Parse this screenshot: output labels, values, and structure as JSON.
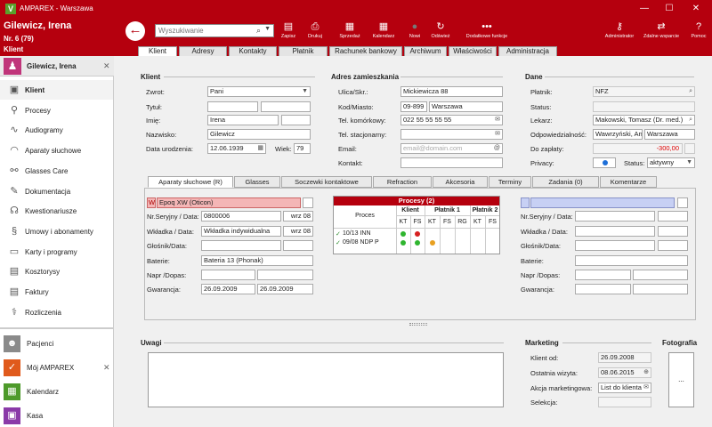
{
  "window": {
    "app": "AMPAREX",
    "location": "Warszawa",
    "minimize": "—",
    "maximize": "☐",
    "close": "✕"
  },
  "patient": {
    "name": "Gilewicz, Irena",
    "number": "Nr. 6 (79)",
    "type": "Klient"
  },
  "search": {
    "placeholder": "Wyszukiwanie"
  },
  "toolbar": [
    {
      "label": "Zapisz",
      "icon": "save-icon",
      "glyph": "▤"
    },
    {
      "label": "Drukuj",
      "icon": "print-icon",
      "glyph": "⎙"
    },
    {
      "label": "Sprzedaż",
      "icon": "sale-icon",
      "glyph": "▦"
    },
    {
      "label": "Kalendarz",
      "icon": "calendar-icon",
      "glyph": "▦"
    },
    {
      "label": "Nowi",
      "icon": "new-icon",
      "glyph": "●"
    },
    {
      "label": "Odśwież",
      "icon": "refresh-icon",
      "glyph": "↻"
    },
    {
      "label": "Dodatkowe funkcje",
      "icon": "more-icon",
      "glyph": "•••"
    },
    {
      "label": "Administrator",
      "icon": "key-icon",
      "glyph": "⚷"
    },
    {
      "label": "Zdalne wsparcie",
      "icon": "remote-icon",
      "glyph": "⇄"
    },
    {
      "label": "Pomoc",
      "icon": "help-icon",
      "glyph": "?"
    }
  ],
  "main_tabs": [
    "Klient",
    "Adresy",
    "Kontakty",
    "Płatnik",
    "Rachunek bankowy",
    "Archiwum",
    "Właściwości",
    "Administracja"
  ],
  "sidebar": {
    "patient": "Gilewicz, Irena",
    "items": [
      {
        "label": "Klient",
        "icon": "person-card-icon",
        "glyph": "▣"
      },
      {
        "label": "Procesy",
        "icon": "paperclip-icon",
        "glyph": "⚲"
      },
      {
        "label": "Audiogramy",
        "icon": "audiogram-icon",
        "glyph": "∿"
      },
      {
        "label": "Aparaty słuchowe",
        "icon": "hearing-aid-icon",
        "glyph": "◠"
      },
      {
        "label": "Glasses Care",
        "icon": "glasses-icon",
        "glyph": "⚯"
      },
      {
        "label": "Dokumentacja",
        "icon": "pencil-icon",
        "glyph": "✎"
      },
      {
        "label": "Kwestionariusze",
        "icon": "questionnaire-icon",
        "glyph": "☊"
      },
      {
        "label": "Umowy i abonamenty",
        "icon": "contract-icon",
        "glyph": "§"
      },
      {
        "label": "Karty i programy",
        "icon": "cards-icon",
        "glyph": "▭"
      },
      {
        "label": "Kosztorysy",
        "icon": "estimate-icon",
        "glyph": "▤"
      },
      {
        "label": "Faktury",
        "icon": "invoice-icon",
        "glyph": "▤"
      },
      {
        "label": "Rozliczenia",
        "icon": "caduceus-icon",
        "glyph": "⚕"
      }
    ],
    "nav": [
      {
        "label": "Pacjenci",
        "icon": "patients-icon",
        "glyph": "☻",
        "color": "#8a8a8a"
      },
      {
        "label": "Mój AMPAREX",
        "icon": "clipboard-icon",
        "glyph": "✓",
        "color": "#e05a1c"
      },
      {
        "label": "Kalendarz",
        "icon": "calendar-icon",
        "glyph": "▦",
        "color": "#4d9a2a"
      },
      {
        "label": "Kasa",
        "icon": "cash-register-icon",
        "glyph": "▣",
        "color": "#8a3aa8"
      }
    ]
  },
  "client": {
    "title": "Klient",
    "salutation_label": "Zwrot:",
    "salutation": "Pani",
    "titel_label": "Tytuł:",
    "firstname_label": "Imię:",
    "firstname": "Irena",
    "lastname_label": "Nazwisko:",
    "lastname": "Gilewicz",
    "birth_label": "Data urodzenia:",
    "birth": "12.06.1939",
    "age_label": "Wiek:",
    "age": "79"
  },
  "address": {
    "title": "Adres zamieszkania",
    "street_label": "Ulica/Skr.:",
    "street": "Mickiewicza 88",
    "zip_label": "Kod/Miasto:",
    "zip": "09-899",
    "city": "Warszawa",
    "mobile_label": "Tel. komórkowy:",
    "mobile": "022 55 55 55 55",
    "phone_label": "Tel. stacjonarny:",
    "email_label": "Email:",
    "email_placeholder": "email@domain.com",
    "contact_label": "Kontakt:"
  },
  "data": {
    "title": "Dane",
    "payer_label": "Płatnik:",
    "payer": "NFZ",
    "status_label": "Status:",
    "doctor_label": "Lekarz:",
    "doctor": "Makowski, Tomasz (Dr. med.)",
    "branch_label": "Odpowiedzialność:",
    "branch1": "Wawrzyński, An",
    "branch2": "Warszawa",
    "due_label": "Do zapłaty:",
    "due": "-300,00",
    "privacy_label": "Privacy:",
    "status2_label": "Status:",
    "status2": "aktywny"
  },
  "subtabs": [
    "Aparaty słuchowe (R)",
    "Glasses",
    "Soczewki kontaktowe",
    "Refraction",
    "Akcesoria",
    "Terminy",
    "Zadania (0)",
    "Komentarze"
  ],
  "hearing": {
    "side": "W",
    "device": "Epoq XW (Oticon)",
    "serial_label": "Nr.Seryjny / Data:",
    "serial": "0800006",
    "serial_date": "wrz 08",
    "earmold_label": "Wkładka / Data:",
    "earmold": "Wkładka indywidualna",
    "earmold_date": "wrz 08",
    "speaker_label": "Głośnik/Data:",
    "battery_label": "Baterie:",
    "battery": "Bateria 13 (Phonak)",
    "repair_label": "Napr /Dopas:",
    "warranty_label": "Gwarancja:",
    "warranty1": "26.09.2009",
    "warranty2": "26.09.2009"
  },
  "hearing_right": {
    "serial_label": "Nr.Seryjny / Data:",
    "earmold_label": "Wkładka / Data:",
    "speaker_label": "Głośnik/Data:",
    "battery_label": "Baterie:",
    "repair_label": "Napr /Dopas:",
    "warranty_label": "Gwarancja:"
  },
  "processes": {
    "title": "Procesy (2)",
    "col_proces": "Proces",
    "groups": [
      "Klient",
      "Płatnik 1",
      "Płatnik 2"
    ],
    "subcols": [
      "KT",
      "FS",
      "KT",
      "FS",
      "RG",
      "KT",
      "FS"
    ],
    "rows": [
      {
        "check": "✓",
        "name": "10/13 INN",
        "dots": [
          "#2fb52f",
          "#d62020",
          "",
          "",
          "",
          "",
          ""
        ]
      },
      {
        "check": "✓",
        "name": "09/08 NDP P",
        "dots": [
          "#2fb52f",
          "#2fb52f",
          "#e8a020",
          "",
          "",
          "",
          ""
        ]
      }
    ]
  },
  "notes": {
    "title": "Uwagi"
  },
  "marketing": {
    "title": "Marketing",
    "since_label": "Klient od:",
    "since": "26.09.2008",
    "visit_label": "Ostatnia wizyta:",
    "visit": "08.06.2015",
    "action_label": "Akcja marketingowa:",
    "action": "List do klienta",
    "selection_label": "Selekcja:"
  },
  "photo": {
    "title": "Fotografia",
    "button": "..."
  }
}
